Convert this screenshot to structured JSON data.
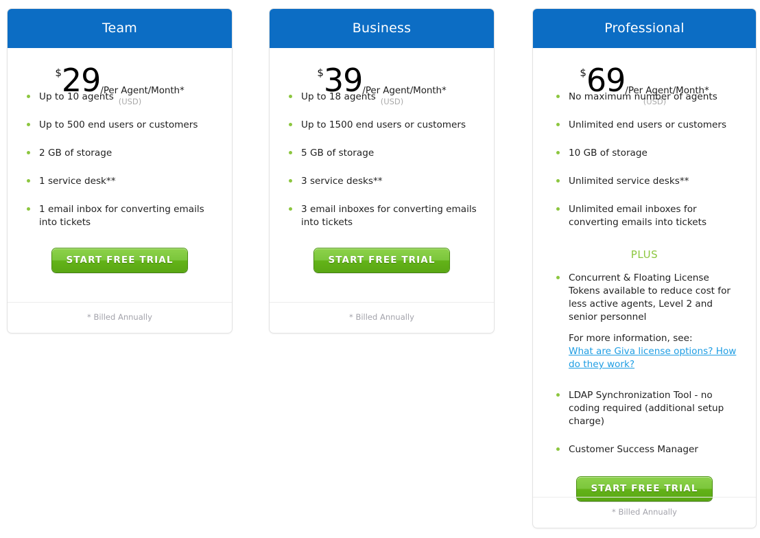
{
  "colors": {
    "header_blue": "#0c6dc4",
    "button_green": "#7cc63c",
    "bullet_green": "#8cc63f",
    "link_blue": "#1e9de3",
    "plus_green": "#8cc63f",
    "muted_gray": "#a3a3ab"
  },
  "common": {
    "currency_symbol": "$",
    "per_label": "/Per Agent/Month*",
    "usd_label": "(USD)",
    "cta_label": "START FREE TRIAL",
    "billed_note": "* Billed Annually"
  },
  "plans": [
    {
      "id": "team",
      "name": "Team",
      "price": "29",
      "features": [
        "Up to 10 agents",
        "Up to 500 end users or customers",
        "2 GB of storage",
        "1 service desk**",
        "1 email inbox for converting emails into tickets"
      ]
    },
    {
      "id": "business",
      "name": "Business",
      "price": "39",
      "features": [
        "Up to 18 agents",
        "Up to 1500 end users or customers",
        "5 GB of storage",
        "3 service desks**",
        "3 email inboxes for converting emails into tickets"
      ]
    },
    {
      "id": "professional",
      "name": "Professional",
      "price": "69",
      "features": [
        "No maximum number of agents",
        "Unlimited end users or customers",
        "10 GB of storage",
        "Unlimited service desks**",
        "Unlimited email inboxes for converting emails into tickets"
      ],
      "plus_heading": "PLUS",
      "plus_features": [
        "Concurrent & Floating License Tokens available to reduce cost for less active agents, Level 2 and senior personnel",
        "LDAP Synchronization Tool - no coding required (additional setup charge)",
        "Customer Success Manager"
      ],
      "more_info_label": "For more information, see:",
      "more_info_link": "What are Giva license options? How do they work?"
    }
  ]
}
